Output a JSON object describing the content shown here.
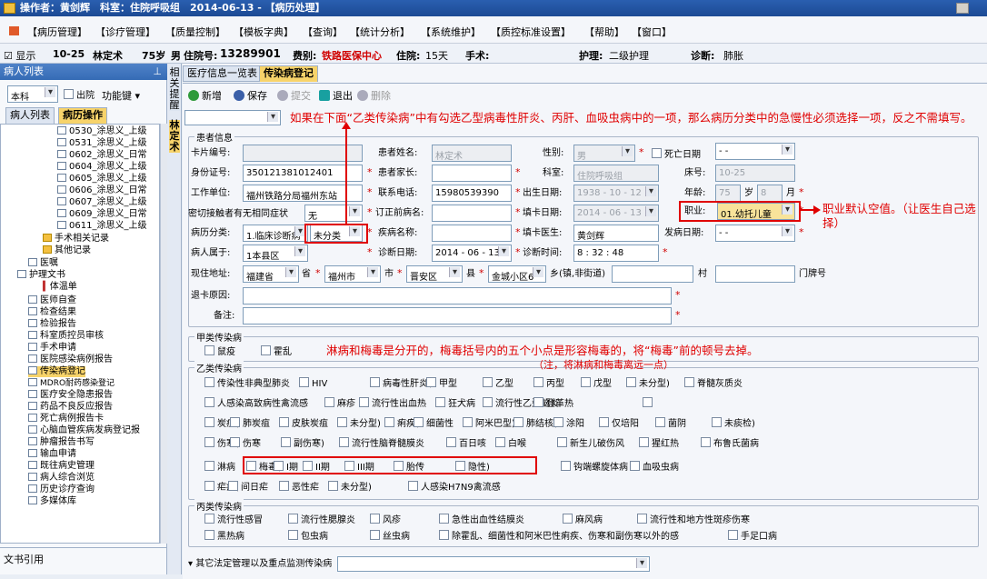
{
  "title": "操作者：黄剑辉　科室：住院呼吸组　2014-06-13 - 【病历处理】",
  "menu": [
    "【病历管理】",
    "【诊疗管理】",
    "【质量控制】",
    "【模板字典】",
    "【查询】",
    "【统计分析】",
    "【系统维护】",
    "【质控标准设置】",
    "【帮助】",
    "【窗口】"
  ],
  "info": {
    "show": "显示",
    "bed": "10-25",
    "name": "林定术",
    "age": "75岁",
    "gender": "男",
    "inpatient_label": "住院号:",
    "inpatient": "13289901",
    "fee_label": "费别:",
    "fee": "铁路医保中心",
    "stay_label": "住院:",
    "stay": "15天",
    "surgery_label": "手术:",
    "nursing_label": "护理:",
    "nursing": "二级护理",
    "diag_label": "诊断:",
    "diag": "肺胀"
  },
  "left": {
    "header": "病人列表",
    "dept": "本科",
    "discharged": "出院",
    "functions": "功能键",
    "tab1": "病人列表",
    "tab2": "病历操作",
    "footer": "文书引用",
    "tree": [
      "0530_涂思义_上级",
      "0531_涂思义_上级",
      "0602_涂思义_日常",
      "0604_涂思义_上级",
      "0605_涂思义_上级",
      "0606_涂思义_日常",
      "0607_涂思义_上级",
      "0609_涂思义_日常",
      "0611_涂思义_上级",
      "手术相关记录",
      "其他记录",
      "医嘱",
      "护理文书",
      "体温单",
      "医师自查",
      "检查结果",
      "检验报告",
      "科室质控员审核",
      "手术申请",
      "医院感染病例报告",
      "传染病登记",
      "MDRO耐药感染登记",
      "医疗安全隐患报告",
      "药品不良反应报告",
      "死亡病例报告卡",
      "心脑血管疾病发病登记报",
      "肿瘤报告书写",
      "输血申请",
      "既往病史管理",
      "病人综合浏览",
      "历史诊疗查询",
      "多媒体库"
    ]
  },
  "vtabs": {
    "a": "相关提醒",
    "b": "林定术"
  },
  "tabs": [
    "医疗信息一览表",
    "传染病登记"
  ],
  "toolbar": [
    "新增",
    "保存",
    "提交",
    "退出",
    "删除"
  ],
  "patient": {
    "legend": "患者信息",
    "card_label": "卡片编号:",
    "pname_label": "患者姓名:",
    "pname": "林定术",
    "sex_label": "性别:",
    "sex": "男",
    "death_label": "死亡日期",
    "death": "-  -",
    "id_label": "身份证号:",
    "id": "350121381012401",
    "parent_label": "患者家长:",
    "dept_label": "科室:",
    "dept": "住院呼吸组",
    "bed_label": "床号:",
    "bed": "10-25",
    "work_label": "工作单位:",
    "work": "福州铁路分局福州东站",
    "phone_label": "联系电话:",
    "phone": "15980539390",
    "birth_label": "出生日期:",
    "birth": "1938 - 10 - 12",
    "age_label": "年龄:",
    "age": "75",
    "age_unit": "岁",
    "month": "8",
    "month_unit": "月",
    "contact_label": "密切接触者有无相同症状",
    "contact": "无",
    "orig_label": "订正前病名:",
    "fill_label": "填卡日期:",
    "fill": "2014 - 06 - 13",
    "job_label": "职业:",
    "job": "01.幼托儿童",
    "cls_label": "病历分类:",
    "cls": "1.临床诊断病",
    "cls2": "未分类",
    "dname_label": "疾病名称:",
    "doctor_label": "填卡医生:",
    "doctor": "黄剑辉",
    "onset_label": "发病日期:",
    "onset": "-  -",
    "belong_label": "病人属于:",
    "belong": "1本县区",
    "diagdate_label": "诊断日期:",
    "diagdate": "2014 - 06 - 13",
    "diagtime_label": "诊断时间:",
    "diagtime": "8 : 32 : 48",
    "addr_label": "现住地址:",
    "prov": "福建省",
    "prov_u": "省",
    "city": "福州市",
    "city_u": "市",
    "county": "晋安区",
    "county_u": "县",
    "town": "金城小区6",
    "town_u": "乡(镇,非街道)",
    "village_u": "村",
    "door_u": "门牌号",
    "reason_label": "退卡原因:",
    "remark_label": "备注:"
  },
  "a_class": {
    "legend": "甲类传染病",
    "items": [
      "鼠疫",
      "霍乱"
    ]
  },
  "b_class": {
    "legend": "乙类传染病",
    "r1": [
      "传染性非典型肺炎",
      "HIV",
      "病毒性肝炎(",
      "甲型",
      "乙型",
      "丙型",
      "戊型",
      "未分型)",
      "脊髓灰质炎"
    ],
    "r2": [
      "人感染高致病性禽流感",
      "麻疹",
      "流行性出血热",
      "狂犬病",
      "流行性乙型脑炎",
      "登革热"
    ],
    "r3": [
      "炭疽(",
      "肺炭疽",
      "皮肤炭疽",
      "未分型)",
      "痢疾(",
      "细菌性",
      "阿米巴型)",
      "肺结核(",
      "涂阳",
      "仅培阳",
      "菌阴",
      "未痰检)"
    ],
    "r4": [
      "伤寒(",
      "伤寒",
      "副伤寒)",
      "流行性脑脊髓膜炎",
      "百日咳",
      "白喉",
      "新生儿破伤风",
      "猩红热",
      "布鲁氏菌病"
    ],
    "r5": [
      "淋病",
      "梅毒(",
      "I期",
      "II期",
      "III期",
      "胎传",
      "隐性)",
      "钩端螺旋体病",
      "血吸虫病"
    ],
    "r6": [
      "疟疾(",
      "间日疟",
      "恶性疟",
      "未分型)",
      "人感染H7N9禽流感"
    ]
  },
  "c_class": {
    "legend": "丙类传染病",
    "r1": [
      "流行性感冒",
      "流行性腮腺炎",
      "风疹",
      "急性出血性结膜炎",
      "麻风病",
      "流行性和地方性斑疹伤寒"
    ],
    "r2": [
      "黑热病",
      "包虫病",
      "丝虫病",
      "除霍乱、细菌性和阿米巴性痢疾、伤寒和副伤寒以外的感",
      "手足口病"
    ]
  },
  "other_label": "其它法定管理以及重点监测传染病",
  "annotations": {
    "top": "如果在下面“乙类传染病”中有勾选乙型病毒性肝炎、丙肝、血吸虫病中的一项，那么病历分类中的急慢性必须选择一项，反之不需填写。",
    "job": "职业默认空值。（让医生自己选择）",
    "syph1": "淋病和梅毒是分开的，梅毒括号内的五个小点是形容梅毒的，将“梅毒”前的顿号去掉。",
    "syph2": "（注，将淋病和梅毒离远一点）"
  },
  "overlay_note": "如果在下面"
}
